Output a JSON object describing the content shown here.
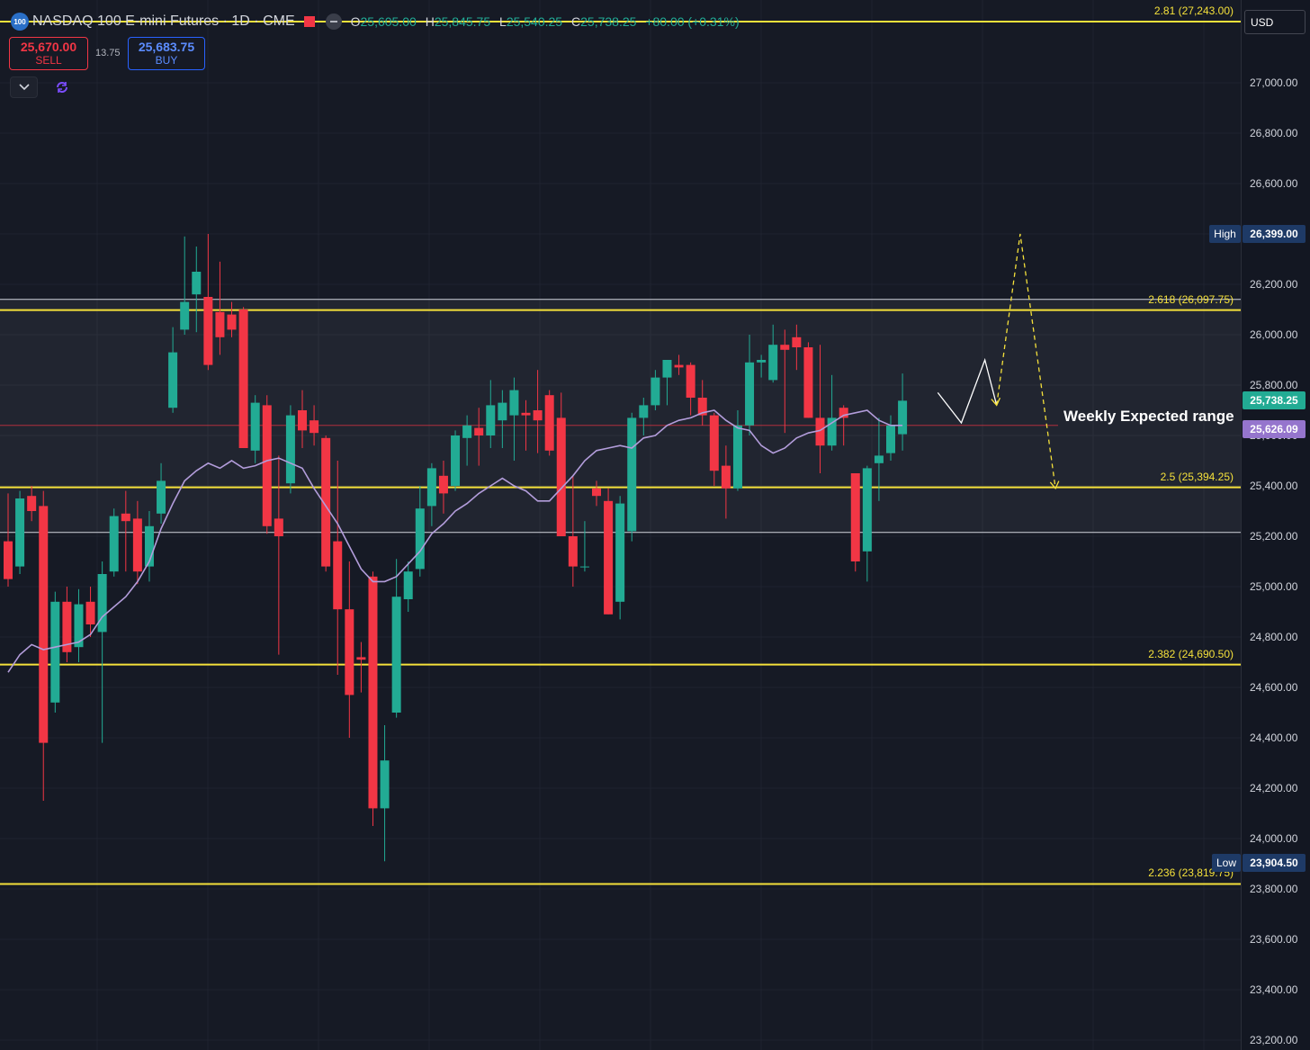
{
  "header": {
    "symbol_badge": "100",
    "title": "NASDAQ 100 E-mini Futures · 1D · CME",
    "ohlc": {
      "o_label": "O",
      "o": "25,605.00",
      "h_label": "H",
      "h": "25,845.75",
      "l_label": "L",
      "l": "25,540.25",
      "c_label": "C",
      "c": "25,738.25",
      "change": "+80.00 (+0.31%)"
    }
  },
  "trade": {
    "sell_price": "25,670.00",
    "sell_label": "SELL",
    "buy_price": "25,683.75",
    "buy_label": "BUY",
    "spread": "13.75"
  },
  "currency": "USD",
  "colors": {
    "up": "#22ab94",
    "down": "#f23645",
    "ma": "#b39ddb",
    "fib": "#f5e13b",
    "grid": "#2a2e39",
    "bg": "#161a25",
    "white_line": "#d1d4dc",
    "tag_blue": "#1e3a66"
  },
  "icons": [
    "chevron-down-icon",
    "sync-icon"
  ],
  "chart_data": {
    "type": "candlestick",
    "ylim": [
      23150,
      27320
    ],
    "y_ticks": [
      "27,000.00",
      "26,800.00",
      "26,600.00",
      "26,400.00",
      "26,200.00",
      "26,000.00",
      "25,800.00",
      "25,600.00",
      "25,400.00",
      "25,200.00",
      "25,000.00",
      "24,800.00",
      "24,600.00",
      "24,400.00",
      "24,200.00",
      "24,000.00",
      "23,800.00",
      "23,600.00",
      "23,400.00",
      "23,200.00"
    ],
    "candles": [
      {
        "o": 25180,
        "h": 25370,
        "l": 25000,
        "c": 25030
      },
      {
        "o": 25080,
        "h": 25380,
        "l": 25050,
        "c": 25350
      },
      {
        "o": 25360,
        "h": 25400,
        "l": 25260,
        "c": 25300
      },
      {
        "o": 25320,
        "h": 25380,
        "l": 24150,
        "c": 24380
      },
      {
        "o": 24540,
        "h": 24980,
        "l": 24500,
        "c": 24940
      },
      {
        "o": 24940,
        "h": 25000,
        "l": 24700,
        "c": 24740
      },
      {
        "o": 24760,
        "h": 24990,
        "l": 24700,
        "c": 24930
      },
      {
        "o": 24940,
        "h": 25000,
        "l": 24800,
        "c": 24850
      },
      {
        "o": 24820,
        "h": 25100,
        "l": 24380,
        "c": 25050
      },
      {
        "o": 25060,
        "h": 25310,
        "l": 25040,
        "c": 25280
      },
      {
        "o": 25290,
        "h": 25380,
        "l": 25060,
        "c": 25260
      },
      {
        "o": 25270,
        "h": 25340,
        "l": 25010,
        "c": 25060
      },
      {
        "o": 25080,
        "h": 25300,
        "l": 25020,
        "c": 25240
      },
      {
        "o": 25290,
        "h": 25490,
        "l": 25250,
        "c": 25420
      },
      {
        "o": 25710,
        "h": 26030,
        "l": 25690,
        "c": 25930
      },
      {
        "o": 26020,
        "h": 26390,
        "l": 26000,
        "c": 26130
      },
      {
        "o": 26160,
        "h": 26350,
        "l": 26010,
        "c": 26250
      },
      {
        "o": 26150,
        "h": 26400,
        "l": 25860,
        "c": 25880
      },
      {
        "o": 26090,
        "h": 26290,
        "l": 25920,
        "c": 25990
      },
      {
        "o": 26080,
        "h": 26130,
        "l": 25990,
        "c": 26020
      },
      {
        "o": 26100,
        "h": 26110,
        "l": 25550,
        "c": 25550
      },
      {
        "o": 25540,
        "h": 25760,
        "l": 25490,
        "c": 25730
      },
      {
        "o": 25720,
        "h": 25760,
        "l": 25210,
        "c": 25240
      },
      {
        "o": 25270,
        "h": 25520,
        "l": 24730,
        "c": 25200
      },
      {
        "o": 25410,
        "h": 25720,
        "l": 25370,
        "c": 25680
      },
      {
        "o": 25700,
        "h": 25780,
        "l": 25550,
        "c": 25620
      },
      {
        "o": 25660,
        "h": 25720,
        "l": 25560,
        "c": 25610
      },
      {
        "o": 25590,
        "h": 25600,
        "l": 25060,
        "c": 25080
      },
      {
        "o": 25180,
        "h": 25500,
        "l": 24650,
        "c": 24910
      },
      {
        "o": 24910,
        "h": 25100,
        "l": 24400,
        "c": 24570
      },
      {
        "o": 24720,
        "h": 24780,
        "l": 24580,
        "c": 24710
      },
      {
        "o": 25040,
        "h": 25060,
        "l": 24050,
        "c": 24120
      },
      {
        "o": 24120,
        "h": 24450,
        "l": 23910,
        "c": 24310
      },
      {
        "o": 24500,
        "h": 25110,
        "l": 24480,
        "c": 24960
      },
      {
        "o": 24950,
        "h": 25100,
        "l": 24900,
        "c": 25060
      },
      {
        "o": 25070,
        "h": 25400,
        "l": 25040,
        "c": 25310
      },
      {
        "o": 25320,
        "h": 25490,
        "l": 25240,
        "c": 25470
      },
      {
        "o": 25440,
        "h": 25500,
        "l": 25290,
        "c": 25370
      },
      {
        "o": 25400,
        "h": 25620,
        "l": 25380,
        "c": 25600
      },
      {
        "o": 25590,
        "h": 25680,
        "l": 25480,
        "c": 25640
      },
      {
        "o": 25630,
        "h": 25710,
        "l": 25480,
        "c": 25600
      },
      {
        "o": 25600,
        "h": 25820,
        "l": 25550,
        "c": 25720
      },
      {
        "o": 25660,
        "h": 25780,
        "l": 25550,
        "c": 25730
      },
      {
        "o": 25680,
        "h": 25830,
        "l": 25500,
        "c": 25780
      },
      {
        "o": 25690,
        "h": 25740,
        "l": 25540,
        "c": 25680
      },
      {
        "o": 25700,
        "h": 25860,
        "l": 25530,
        "c": 25660
      },
      {
        "o": 25760,
        "h": 25780,
        "l": 25520,
        "c": 25540
      },
      {
        "o": 25670,
        "h": 25770,
        "l": 25380,
        "c": 25200
      },
      {
        "o": 25200,
        "h": 25440,
        "l": 25000,
        "c": 25080
      },
      {
        "o": 25080,
        "h": 25260,
        "l": 25060,
        "c": 25080
      },
      {
        "o": 25390,
        "h": 25420,
        "l": 25320,
        "c": 25360
      },
      {
        "o": 25340,
        "h": 25390,
        "l": 24890,
        "c": 24890
      },
      {
        "o": 24940,
        "h": 25360,
        "l": 24870,
        "c": 25330
      },
      {
        "o": 25220,
        "h": 25690,
        "l": 25180,
        "c": 25670
      },
      {
        "o": 25670,
        "h": 25750,
        "l": 25600,
        "c": 25720
      },
      {
        "o": 25720,
        "h": 25860,
        "l": 25700,
        "c": 25830
      },
      {
        "o": 25830,
        "h": 25900,
        "l": 25720,
        "c": 25900
      },
      {
        "o": 25880,
        "h": 25920,
        "l": 25840,
        "c": 25870
      },
      {
        "o": 25880,
        "h": 25890,
        "l": 25680,
        "c": 25750
      },
      {
        "o": 25750,
        "h": 25820,
        "l": 25640,
        "c": 25680
      },
      {
        "o": 25680,
        "h": 25690,
        "l": 25400,
        "c": 25460
      },
      {
        "o": 25480,
        "h": 25560,
        "l": 25270,
        "c": 25390
      },
      {
        "o": 25390,
        "h": 25700,
        "l": 25380,
        "c": 25640
      },
      {
        "o": 25640,
        "h": 26000,
        "l": 25600,
        "c": 25890
      },
      {
        "o": 25890,
        "h": 25920,
        "l": 25830,
        "c": 25900
      },
      {
        "o": 25820,
        "h": 26040,
        "l": 25810,
        "c": 25960
      },
      {
        "o": 25960,
        "h": 26020,
        "l": 25610,
        "c": 25940
      },
      {
        "o": 25990,
        "h": 26040,
        "l": 25860,
        "c": 25950
      },
      {
        "o": 25950,
        "h": 25970,
        "l": 25670,
        "c": 25670
      },
      {
        "o": 25670,
        "h": 25960,
        "l": 25450,
        "c": 25560
      },
      {
        "o": 25560,
        "h": 25840,
        "l": 25540,
        "c": 25670
      },
      {
        "o": 25710,
        "h": 25720,
        "l": 25560,
        "c": 25670
      },
      {
        "o": 25450,
        "h": 25450,
        "l": 25060,
        "c": 25100
      },
      {
        "o": 25140,
        "h": 25480,
        "l": 25020,
        "c": 25470
      },
      {
        "o": 25490,
        "h": 25670,
        "l": 25340,
        "c": 25520
      },
      {
        "o": 25530,
        "h": 25680,
        "l": 25500,
        "c": 25640
      },
      {
        "o": 25605,
        "h": 25846,
        "l": 25540,
        "c": 25738
      }
    ],
    "ma": [
      24660,
      24730,
      24770,
      24750,
      24760,
      24770,
      24780,
      24810,
      24880,
      24920,
      24960,
      25020,
      25100,
      25230,
      25330,
      25420,
      25460,
      25490,
      25470,
      25500,
      25470,
      25480,
      25500,
      25510,
      25490,
      25470,
      25390,
      25320,
      25250,
      25160,
      25070,
      25020,
      25020,
      25040,
      25090,
      25140,
      25210,
      25250,
      25300,
      25330,
      25370,
      25400,
      25430,
      25400,
      25380,
      25340,
      25340,
      25390,
      25440,
      25500,
      25540,
      25550,
      25560,
      25550,
      25590,
      25600,
      25640,
      25660,
      25670,
      25690,
      25700,
      25660,
      25630,
      25620,
      25560,
      25530,
      25550,
      25590,
      25610,
      25620,
      25650,
      25680,
      25690,
      25700,
      25660,
      25640,
      25640
    ],
    "fib_levels": [
      {
        "label": "2.81 (27,243.00)",
        "value": 27243
      },
      {
        "label": "2.618 (26,097.75)",
        "value": 26097.75
      },
      {
        "label": "2.5 (25,394.25)",
        "value": 25394.25
      },
      {
        "label": "2.382 (24,690.50)",
        "value": 24690.5
      },
      {
        "label": "2.236 (23,819.75)",
        "value": 23819.75
      }
    ],
    "range_lines": [
      26140,
      25215
    ],
    "last_price_line": 25640,
    "projection_white": [
      [
        79,
        25770
      ],
      [
        81,
        25650
      ],
      [
        83,
        25900
      ],
      [
        84,
        25720
      ]
    ],
    "projection_yellow": [
      [
        84,
        25720
      ],
      [
        86,
        26400
      ],
      [
        89,
        25390
      ]
    ],
    "price_tags": [
      {
        "name": "last-price-tag",
        "value": 25738.25,
        "text": "25,738.25",
        "color": "#22ab94"
      },
      {
        "name": "ma-price-tag",
        "value": 25626.09,
        "text": "25,626.09",
        "color": "#9575cd"
      }
    ],
    "high": {
      "label": "High",
      "value": 26399,
      "text": "26,399.00"
    },
    "low": {
      "label": "Low",
      "value": 23904.5,
      "text": "23,904.50"
    },
    "annotation": "Weekly Expected range"
  }
}
